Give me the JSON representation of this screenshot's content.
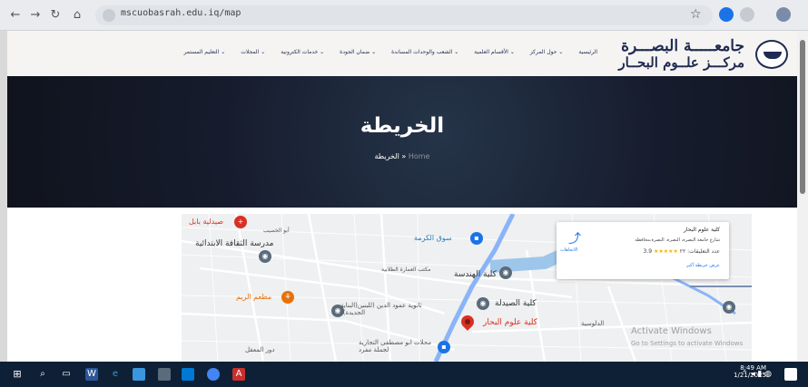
{
  "browser": {
    "url": "mscuobasrah.edu.iq/map",
    "back_icon": "arrow-left",
    "forward_icon": "arrow-right",
    "reload_icon": "reload",
    "home_icon": "home",
    "star_icon": "star"
  },
  "site": {
    "logo_line1": "جامعـــــة البصـــرة",
    "logo_line2": "مركـــز علــوم البحــار",
    "nav": [
      "الرئيسية",
      "حول المركز ⌄",
      "الأقسام العلمية ⌄",
      "الشعب والوحدات المساندة ⌄",
      "ضمان الجودة ⌄",
      "خدمات الكترونية ⌄",
      "المجلات ⌄",
      "التعليم المستمر ⌄"
    ]
  },
  "hero": {
    "title": "الخريطة",
    "crumb_current": "الخريطة",
    "crumb_separator": "»",
    "crumb_home": "Home"
  },
  "map": {
    "popup": {
      "title": "كلية علوم البحار",
      "address": "شارع جامعة البصرة، البصرة، البصرة،محافظة",
      "rating": "3.9",
      "stars": "★★★★★",
      "reviews": "عدد التعليقات: ٢٢",
      "directions": "الاتجاهات",
      "larger_map": "عرض خريطة أكبر"
    },
    "labels": {
      "pharmacy": "صيدلية بابل",
      "school": "مدرسة الثقافة الابتدائية",
      "area_top": "أبو الخصيب",
      "market": "سوق الكرمة",
      "college_eng": "كلية الهندسة",
      "college_pharm": "كلية الصيدلة",
      "college_marine": "كلية علوم البحار",
      "secondary_school": "ثانوية عمود الدين (للبنين(البناية الجديدة))",
      "restaurant": "مطعم الريم",
      "shop_bottom": "محلات ابو مصطفى التجارية لجملة مفرد",
      "area_bottom": "دور المعقل",
      "area_right": "الدلوسية",
      "area_mid": "مكتب العمارة الطلابية",
      "activate_windows": "Activate Windows",
      "activate_hint": "Go to Settings to activate Windows"
    }
  },
  "taskbar": {
    "time": "8:49 AM",
    "date": "1/21/2025"
  }
}
